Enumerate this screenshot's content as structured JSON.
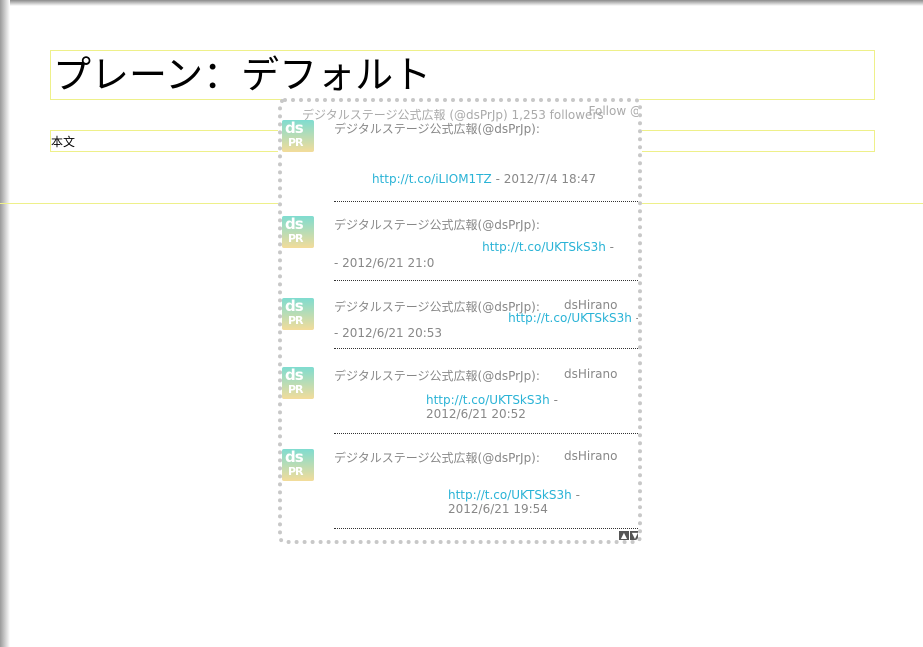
{
  "page": {
    "title": "プレーン：デフォルト",
    "body_label": "本文"
  },
  "widget": {
    "header": "デジタルステージ公式広報 (@dsPrJp) 1,253 followers",
    "follow": "Follow @",
    "avatar_top": "ds",
    "avatar_bottom": "PR",
    "tweets": [
      {
        "author": "デジタルステージ公式広報(@dsPrJp):",
        "user": "",
        "link": "http://t.co/iLIOM1TZ",
        "date": " - 2012/7/4 18:47"
      },
      {
        "author": "デジタルステージ公式広報(@dsPrJp):",
        "user": "",
        "link": "http://t.co/UKTSkS3h",
        "date": " - 2012/6/21 21:0"
      },
      {
        "author": "デジタルステージ公式広報(@dsPrJp):",
        "user": "dsHirano",
        "link": "http://t.co/UKTSkS3h",
        "date": " - 2012/6/21 20:53"
      },
      {
        "author": "デジタルステージ公式広報(@dsPrJp):",
        "user": "dsHirano",
        "link": "http://t.co/UKTSkS3h",
        "date": " - 2012/6/21 20:52"
      },
      {
        "author": "デジタルステージ公式広報(@dsPrJp):",
        "user": "dsHirano",
        "link": "http://t.co/UKTSkS3h",
        "date": " - 2012/6/21 19:54"
      }
    ],
    "scroll_up": "▲",
    "scroll_down": "▼"
  }
}
